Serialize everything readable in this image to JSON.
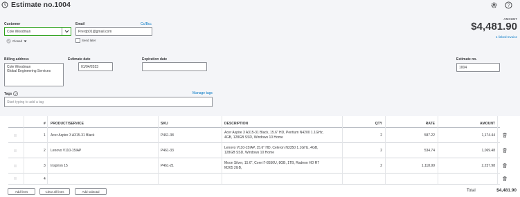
{
  "header": {
    "title": "Estimate no.1004"
  },
  "customer": {
    "label": "Customer",
    "value": "Cole Woodman",
    "status": "Closed"
  },
  "email": {
    "label": "Email",
    "value": "Prerqb01@gmail.com",
    "cc_link": "Cc/Bcc",
    "send_later": "Send later"
  },
  "amount": {
    "label": "AMOUNT",
    "value": "$4,481.90",
    "linked": "1 linked Invoice"
  },
  "billing": {
    "label": "Billing address",
    "line1": "Cole Woodman",
    "line2": "Global Engineering Services"
  },
  "estimate_date": {
    "label": "Estimate date",
    "value": "01/04/2023"
  },
  "expiration_date": {
    "label": "Expiration date",
    "value": ""
  },
  "estimate_no": {
    "label": "Estimate no.",
    "value": "1004"
  },
  "tags": {
    "label": "Tags",
    "manage": "Manage tags",
    "placeholder": "Start typing to add a tag"
  },
  "table": {
    "headers": {
      "num": "#",
      "product": "PRODUCT/SERVICE",
      "sku": "SKU",
      "description": "DESCRIPTION",
      "qty": "QTY",
      "rate": "RATE",
      "amount": "AMOUNT"
    },
    "rows": [
      {
        "num": "1",
        "product": "Acer Aspire 3 A315-31 Black",
        "sku": "P461-38",
        "desc1": "Acer Aspire 3 A315-31 Black, 15.6\" HD, Pentium N4200 1.1GHz,",
        "desc2": "4GB, 128GB SSD, Windows 10 Home",
        "qty": "2",
        "rate": "587.22",
        "amount": "1,174.44"
      },
      {
        "num": "2",
        "product": "Lenovo V110-15IAP",
        "sku": "P461-33",
        "desc1": "Lenovo V110-15IAP, 15.6\" HD, Celeron N3350 1.1GHz, 4GB,",
        "desc2": "128GB SSD, Windows 10 Home",
        "qty": "2",
        "rate": "534.74",
        "amount": "1,069.48"
      },
      {
        "num": "3",
        "product": "Inspiron 15",
        "sku": "P461-21",
        "desc1": "Moon Silver, 15.6\", Core i7-8550U, 8GB, 1TB, Radeon HD R7",
        "desc2": "M265 2GB,",
        "qty": "2",
        "rate": "1,118.99",
        "amount": "2,237.98"
      },
      {
        "num": "4",
        "product": "",
        "sku": "",
        "desc1": "",
        "desc2": "",
        "qty": "",
        "rate": "",
        "amount": ""
      }
    ]
  },
  "buttons": {
    "add_lines": "Add lines",
    "clear_all": "Clear all lines",
    "add_subtotal": "Add subtotal"
  },
  "total": {
    "label": "Total",
    "value": "$4,481.90"
  },
  "icons": {
    "history": "history-icon",
    "settings": "gear-icon",
    "help": "help-icon",
    "dropdown": "chevron-down-icon",
    "trash": "trash-icon",
    "drag": "drag-handle-icon"
  }
}
